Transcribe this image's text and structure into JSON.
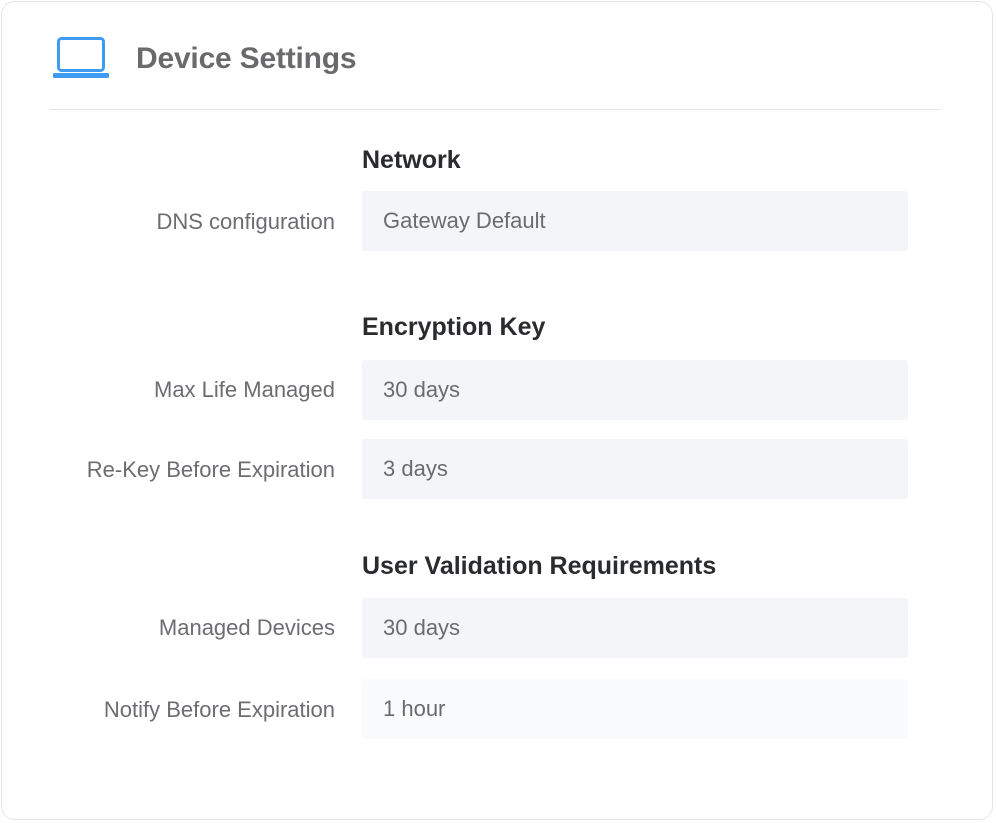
{
  "header": {
    "title": "Device Settings",
    "icon": "laptop-icon",
    "icon_color": "#3f9bf2"
  },
  "sections": [
    {
      "title": "Network",
      "rows": [
        {
          "label": "DNS configuration",
          "value": "Gateway Default"
        }
      ]
    },
    {
      "title": "Encryption Key",
      "rows": [
        {
          "label": "Max Life Managed",
          "value": "30 days"
        },
        {
          "label": "Re-Key Before Expiration",
          "value": "3 days"
        }
      ]
    },
    {
      "title": "User Validation Requirements",
      "rows": [
        {
          "label": "Managed Devices",
          "value": "30 days"
        },
        {
          "label": "Notify Before Expiration",
          "value": "1 hour"
        }
      ]
    }
  ]
}
